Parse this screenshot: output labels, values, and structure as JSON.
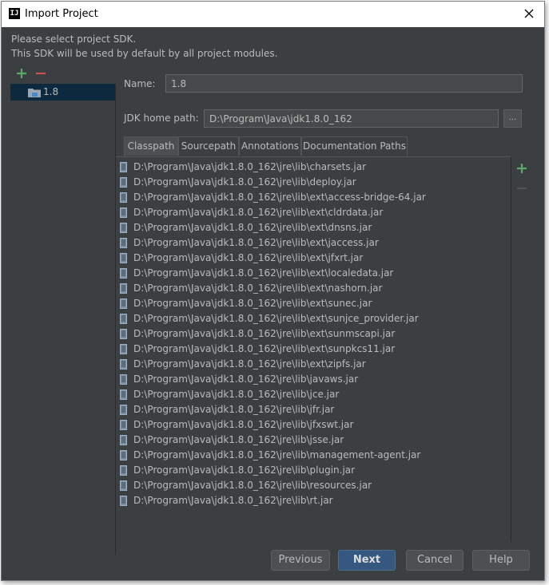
{
  "window": {
    "title": "Import Project",
    "app_icon": "IJ"
  },
  "description": {
    "line1": "Please select project SDK.",
    "line2": "This SDK will be used by default by all project modules."
  },
  "sdks": {
    "items": [
      {
        "label": "1.8",
        "icon": "folder-icon"
      }
    ]
  },
  "form": {
    "name_label": "Name:",
    "name_value": "1.8",
    "jdk_label": "JDK home path:",
    "jdk_value": "D:\\Program\\Java\\jdk1.8.0_162",
    "browse_label": "..."
  },
  "tabs": [
    {
      "label": "Classpath",
      "active": true
    },
    {
      "label": "Sourcepath",
      "active": false
    },
    {
      "label": "Annotations",
      "active": false
    },
    {
      "label": "Documentation Paths",
      "active": false
    }
  ],
  "classpath": [
    "D:\\Program\\Java\\jdk1.8.0_162\\jre\\lib\\charsets.jar",
    "D:\\Program\\Java\\jdk1.8.0_162\\jre\\lib\\deploy.jar",
    "D:\\Program\\Java\\jdk1.8.0_162\\jre\\lib\\ext\\access-bridge-64.jar",
    "D:\\Program\\Java\\jdk1.8.0_162\\jre\\lib\\ext\\cldrdata.jar",
    "D:\\Program\\Java\\jdk1.8.0_162\\jre\\lib\\ext\\dnsns.jar",
    "D:\\Program\\Java\\jdk1.8.0_162\\jre\\lib\\ext\\jaccess.jar",
    "D:\\Program\\Java\\jdk1.8.0_162\\jre\\lib\\ext\\jfxrt.jar",
    "D:\\Program\\Java\\jdk1.8.0_162\\jre\\lib\\ext\\localedata.jar",
    "D:\\Program\\Java\\jdk1.8.0_162\\jre\\lib\\ext\\nashorn.jar",
    "D:\\Program\\Java\\jdk1.8.0_162\\jre\\lib\\ext\\sunec.jar",
    "D:\\Program\\Java\\jdk1.8.0_162\\jre\\lib\\ext\\sunjce_provider.jar",
    "D:\\Program\\Java\\jdk1.8.0_162\\jre\\lib\\ext\\sunmscapi.jar",
    "D:\\Program\\Java\\jdk1.8.0_162\\jre\\lib\\ext\\sunpkcs11.jar",
    "D:\\Program\\Java\\jdk1.8.0_162\\jre\\lib\\ext\\zipfs.jar",
    "D:\\Program\\Java\\jdk1.8.0_162\\jre\\lib\\javaws.jar",
    "D:\\Program\\Java\\jdk1.8.0_162\\jre\\lib\\jce.jar",
    "D:\\Program\\Java\\jdk1.8.0_162\\jre\\lib\\jfr.jar",
    "D:\\Program\\Java\\jdk1.8.0_162\\jre\\lib\\jfxswt.jar",
    "D:\\Program\\Java\\jdk1.8.0_162\\jre\\lib\\jsse.jar",
    "D:\\Program\\Java\\jdk1.8.0_162\\jre\\lib\\management-agent.jar",
    "D:\\Program\\Java\\jdk1.8.0_162\\jre\\lib\\plugin.jar",
    "D:\\Program\\Java\\jdk1.8.0_162\\jre\\lib\\resources.jar",
    "D:\\Program\\Java\\jdk1.8.0_162\\jre\\lib\\rt.jar"
  ],
  "buttons": {
    "previous": "Previous",
    "next": "Next",
    "cancel": "Cancel",
    "help": "Help"
  },
  "colors": {
    "background": "#3c3f41",
    "add": "#59a869",
    "remove": "#c75450",
    "selection": "#0d293e",
    "primary_button": "#365880"
  },
  "icons": {
    "add": "plus-icon",
    "remove": "minus-icon",
    "jar": "jar-icon",
    "close": "close-icon"
  }
}
